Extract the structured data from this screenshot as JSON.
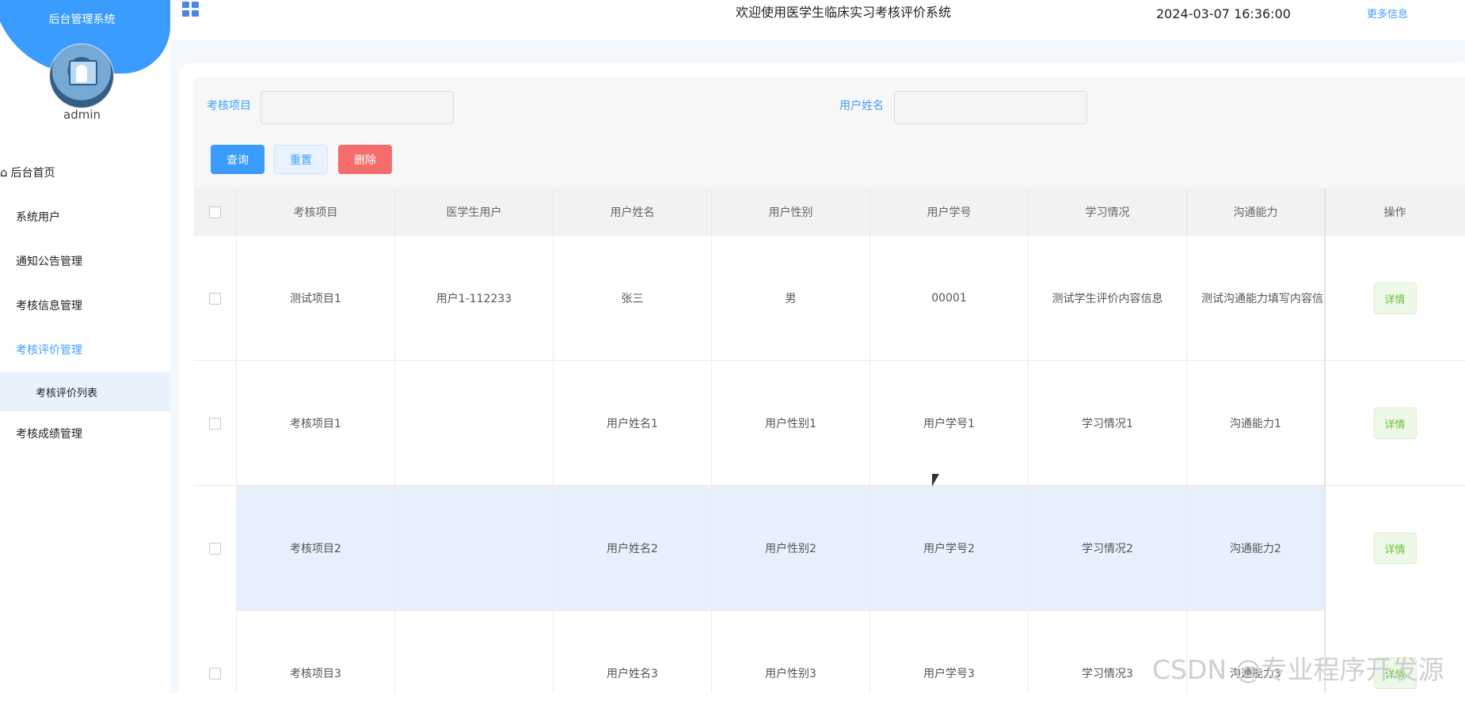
{
  "sidebar": {
    "title": "后台管理系统",
    "username": "admin",
    "items": [
      {
        "label": "后台首页"
      },
      {
        "label": "系统用户"
      },
      {
        "label": "通知公告管理"
      },
      {
        "label": "考核信息管理"
      },
      {
        "label": "考核评价管理"
      },
      {
        "label": "考核评价列表"
      },
      {
        "label": "考核成绩管理"
      }
    ]
  },
  "header": {
    "welcome": "欢迎使用医学生临床实习考核评价系统",
    "datetime": "2024-03-07 16:36:00",
    "more_info": "更多信息"
  },
  "search": {
    "project_label": "考核项目",
    "project_value": "",
    "name_label": "用户姓名",
    "name_value": "",
    "query": "查询",
    "reset": "重置",
    "delete": "删除"
  },
  "table": {
    "headers": [
      "考核项目",
      "医学生用户",
      "用户姓名",
      "用户性别",
      "用户学号",
      "学习情况",
      "沟通能力",
      "操作"
    ],
    "rows": [
      [
        "测试项目1",
        "用户1-112233",
        "张三",
        "男",
        "00001",
        "测试学生评价内容信息",
        "测试沟通能力填写内容信息",
        "详情"
      ],
      [
        "考核项目1",
        "",
        "用户姓名1",
        "用户性别1",
        "用户学号1",
        "学习情况1",
        "沟通能力1",
        "详情"
      ],
      [
        "考核项目2",
        "",
        "用户姓名2",
        "用户性别2",
        "用户学号2",
        "学习情况2",
        "沟通能力2",
        "详情"
      ],
      [
        "考核项目3",
        "",
        "用户姓名3",
        "用户性别3",
        "用户学号3",
        "学习情况3",
        "沟通能力3",
        "详情"
      ]
    ]
  },
  "watermark": "CSDN @专业程序开发源",
  "colors": {
    "primary": "#3a9cff",
    "danger": "#f56c6c",
    "success": "#67c23a",
    "highlight_row": "#e8f0fe"
  }
}
